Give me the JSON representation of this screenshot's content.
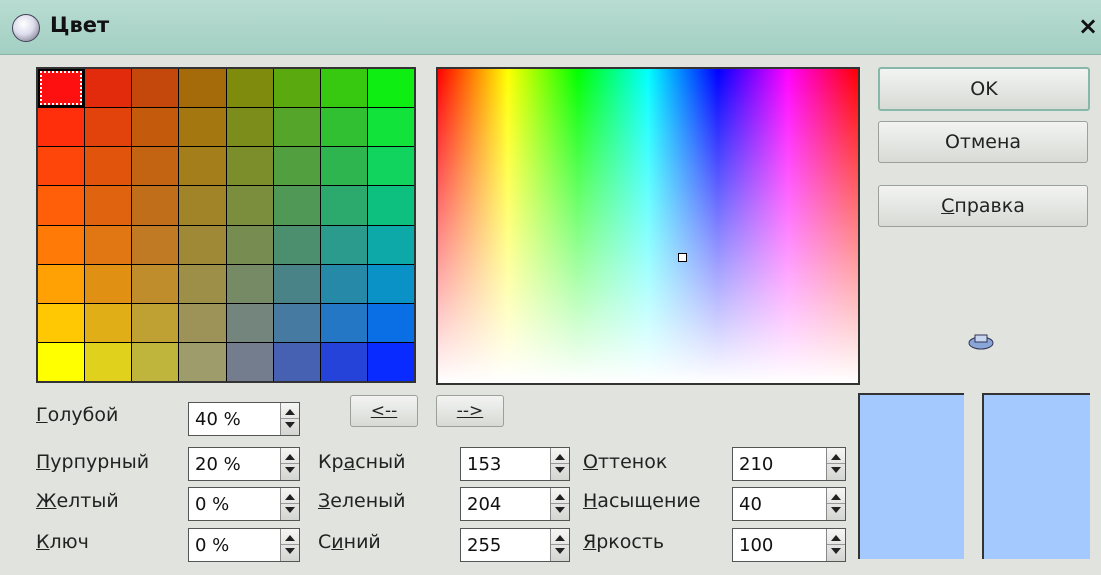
{
  "window": {
    "title": "Цвет",
    "close_label": "×"
  },
  "palette": {
    "rows": [
      [
        "#ff1010",
        "#e22a0d",
        "#c4470c",
        "#a56a0a",
        "#7e8b0c",
        "#5aa90e",
        "#36c910",
        "#0fee12"
      ],
      [
        "#ff2f0c",
        "#e2420b",
        "#c45a0b",
        "#a57710",
        "#7d8d1c",
        "#55a52b",
        "#32c033",
        "#11e33b"
      ],
      [
        "#ff460a",
        "#e1540c",
        "#c26412",
        "#a37e1a",
        "#7b8e2b",
        "#529f3f",
        "#2fb54f",
        "#10d45d"
      ],
      [
        "#ff5f08",
        "#e0640f",
        "#c06e1a",
        "#a18328",
        "#7a8e3e",
        "#4f9856",
        "#2ca96c",
        "#0ec07f"
      ],
      [
        "#ff7a06",
        "#e07712",
        "#bf7a23",
        "#a08936",
        "#778c50",
        "#4c8f6e",
        "#2a9b8c",
        "#0ca9a8"
      ],
      [
        "#ffa004",
        "#e09114",
        "#bf8d2c",
        "#9e8f48",
        "#768a66",
        "#498388",
        "#2689a8",
        "#0a92c7"
      ],
      [
        "#ffc802",
        "#e0af18",
        "#bfa033",
        "#9d9358",
        "#73857c",
        "#477aa0",
        "#2477c4",
        "#0a6fe4"
      ],
      [
        "#ffff00",
        "#e0d21c",
        "#bfb53c",
        "#9d9c6a",
        "#737d8e",
        "#4660b2",
        "#2543d8",
        "#0a2bff"
      ]
    ]
  },
  "buttons": {
    "ok": "OK",
    "cancel": "Отмена",
    "help": "Справка",
    "left_arrow": "<--",
    "right_arrow": "-->"
  },
  "cmyk": [
    {
      "label": "Голубой",
      "mnemonic": "Г",
      "rest": "олубой",
      "value": "40 %"
    },
    {
      "label": "Пурпурный",
      "mnemonic": "П",
      "rest": "урпурный",
      "value": "20 %"
    },
    {
      "label": "Желтый",
      "mnemonic": "Ж",
      "rest": "елтый",
      "value": "0 %"
    },
    {
      "label": "Ключ",
      "mnemonic": "К",
      "rest": "люч",
      "value": "0 %"
    }
  ],
  "rgb": [
    {
      "label": "Красный",
      "pre": "Кр",
      "mnemonic": "а",
      "rest": "сный",
      "value": "153"
    },
    {
      "label": "Зеленый",
      "pre": "",
      "mnemonic": "З",
      "rest": "еленый",
      "value": "204"
    },
    {
      "label": "Синий",
      "pre": "С",
      "mnemonic": "и",
      "rest": "ний",
      "value": "255"
    }
  ],
  "hsb": [
    {
      "label": "Оттенок",
      "mnemonic": "О",
      "rest": "ттенок",
      "value": "210"
    },
    {
      "label": "Насыщение",
      "mnemonic": "Н",
      "rest": "асыщение",
      "value": "40"
    },
    {
      "label": "Яркость",
      "mnemonic": "Я",
      "rest": "ркость",
      "value": "100"
    }
  ],
  "preview": {
    "original_color": "#a3c9ff",
    "new_color": "#a3c9ff"
  }
}
